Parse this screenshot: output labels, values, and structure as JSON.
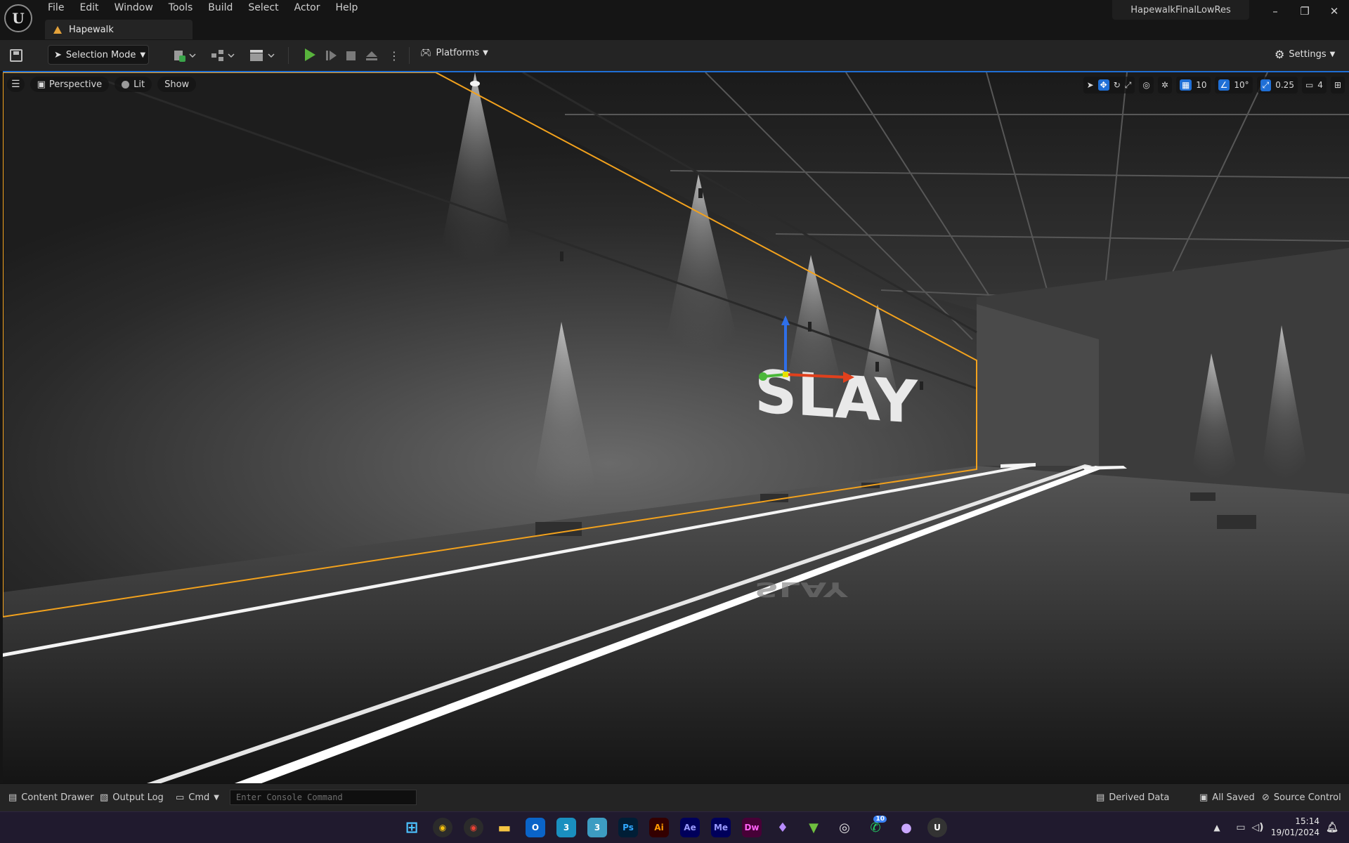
{
  "app": {
    "project_name": "HapewalkFinalLowRes",
    "level_tab": "Hapewalk"
  },
  "menu": [
    "File",
    "Edit",
    "Window",
    "Tools",
    "Build",
    "Select",
    "Actor",
    "Help"
  ],
  "window_controls": {
    "minimize": "–",
    "restore": "❐",
    "close": "✕"
  },
  "toolbar": {
    "selection_mode": "Selection Mode",
    "platforms": "Platforms",
    "settings": "Settings"
  },
  "viewport": {
    "perspective": "Perspective",
    "lit": "Lit",
    "show": "Show",
    "grid_snap": "10",
    "rotation_snap": "10°",
    "scale_snap": "0.25",
    "camera_speed": "4",
    "scene_text": "SLAY",
    "selection_color": "#f3a21d"
  },
  "statusbar": {
    "content_drawer": "Content Drawer",
    "output_log": "Output Log",
    "cmd": "Cmd",
    "console_placeholder": "Enter Console Command",
    "derived_data": "Derived Data",
    "all_saved": "All Saved",
    "source_control": "Source Control"
  },
  "taskbar": {
    "time": "15:14",
    "date": "19/01/2024",
    "whatsapp_badge": "10",
    "apps": [
      "Ps",
      "Ai",
      "Ae",
      "Me",
      "Dw"
    ]
  }
}
